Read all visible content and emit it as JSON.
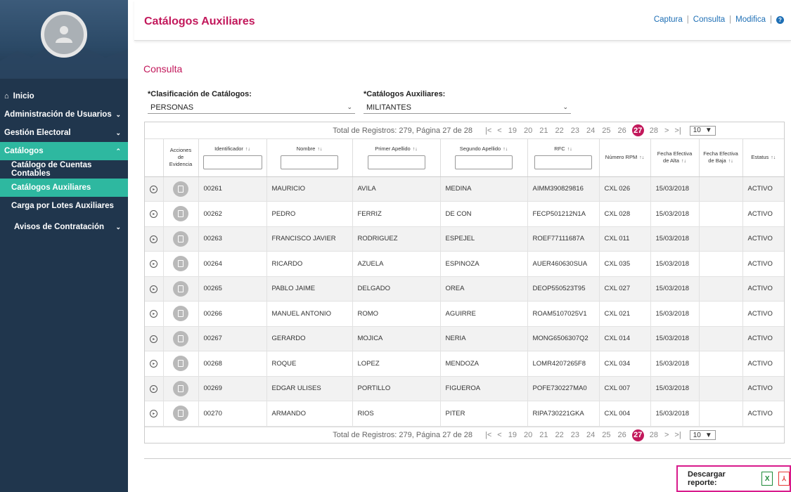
{
  "sidebar": {
    "items": [
      {
        "label": "Inicio",
        "icon": "home-icon",
        "chevron": ""
      },
      {
        "label": "Administración de Usuarios",
        "chevron": "⌄"
      },
      {
        "label": "Gestión Electoral",
        "chevron": "⌄"
      },
      {
        "label": "Catálogos",
        "chevron": "⌃"
      }
    ],
    "subitems": [
      {
        "label": "Catálogo de Cuentas Contables"
      },
      {
        "label": "Catálogos Auxiliares"
      },
      {
        "label": "Carga por Lotes Auxiliares"
      }
    ],
    "after": {
      "label": "Avisos de Contratación",
      "chevron": "⌄"
    }
  },
  "header": {
    "title": "Catálogos Auxiliares",
    "links": [
      "Captura",
      "Consulta",
      "Modifica"
    ],
    "separator": "|",
    "help": "?"
  },
  "section_title": "Consulta",
  "filters": {
    "clasificacion_label": "*Clasificación de Catálogos:",
    "clasificacion_value": "PERSONAS",
    "auxiliares_label": "*Catálogos Auxiliares:",
    "auxiliares_value": "MILITANTES"
  },
  "pager": {
    "summary": "Total de Registros: 279, Página 27 de 28",
    "first": "|<",
    "prev": "<",
    "pages": [
      "19",
      "20",
      "21",
      "22",
      "23",
      "24",
      "25",
      "26",
      "27",
      "28"
    ],
    "current": "27",
    "next": ">",
    "last": ">|",
    "per_page": "10",
    "per_page_arrow": "▼"
  },
  "table": {
    "headers": {
      "acciones": [
        "Acciones",
        "de",
        "Evidencia"
      ],
      "identificador": "Identificador",
      "nombre": "Nombre",
      "primer_apellido": "Primer Apellido",
      "segundo_apellido": "Segundo Apellido",
      "rfc": "RFC",
      "numero_rpm": "Número RPM",
      "fecha_alta": [
        "Fecha Efectiva",
        "de Alta"
      ],
      "fecha_baja": [
        "Fecha Efectiva",
        "de Baja"
      ],
      "estatus": "Estatus",
      "sort": "↑↓"
    },
    "rows": [
      [
        "00261",
        "MAURICIO",
        "AVILA",
        "MEDINA",
        "AIMM390829816",
        "CXL 026",
        "15/03/2018",
        "",
        "ACTIVO"
      ],
      [
        "00262",
        "PEDRO",
        "FERRIZ",
        "DE CON",
        "FECP501212N1A",
        "CXL 028",
        "15/03/2018",
        "",
        "ACTIVO"
      ],
      [
        "00263",
        "FRANCISCO JAVIER",
        "RODRIGUEZ",
        "ESPEJEL",
        "ROEF77111687A",
        "CXL 011",
        "15/03/2018",
        "",
        "ACTIVO"
      ],
      [
        "00264",
        "RICARDO",
        "AZUELA",
        "ESPINOZA",
        "AUER460630SUA",
        "CXL 035",
        "15/03/2018",
        "",
        "ACTIVO"
      ],
      [
        "00265",
        "PABLO JAIME",
        "DELGADO",
        "OREA",
        "DEOP550523T95",
        "CXL 027",
        "15/03/2018",
        "",
        "ACTIVO"
      ],
      [
        "00266",
        "MANUEL ANTONIO",
        "ROMO",
        "AGUIRRE",
        "ROAM5107025V1",
        "CXL 021",
        "15/03/2018",
        "",
        "ACTIVO"
      ],
      [
        "00267",
        "GERARDO",
        "MOJICA",
        "NERIA",
        "MONG6506307Q2",
        "CXL 014",
        "15/03/2018",
        "",
        "ACTIVO"
      ],
      [
        "00268",
        "ROQUE",
        "LOPEZ",
        "MENDOZA",
        "LOMR4207265F8",
        "CXL 034",
        "15/03/2018",
        "",
        "ACTIVO"
      ],
      [
        "00269",
        "EDGAR ULISES",
        "PORTILLO",
        "FIGUEROA",
        "POFE730227MA0",
        "CXL 007",
        "15/03/2018",
        "",
        "ACTIVO"
      ],
      [
        "00270",
        "ARMANDO",
        "RIOS",
        "PITER",
        "RIPA730221GKA",
        "CXL 004",
        "15/03/2018",
        "",
        "ACTIVO"
      ]
    ]
  },
  "download": {
    "label": "Descargar reporte:",
    "excel_glyph": "X",
    "pdf_glyph": "⅄"
  },
  "colors": {
    "sidebar_bg": "#20364d",
    "sidebar_active": "#2eb8a0",
    "title": "#c2185b",
    "link": "#1e6fb5",
    "download_border": "#d81b8c"
  }
}
